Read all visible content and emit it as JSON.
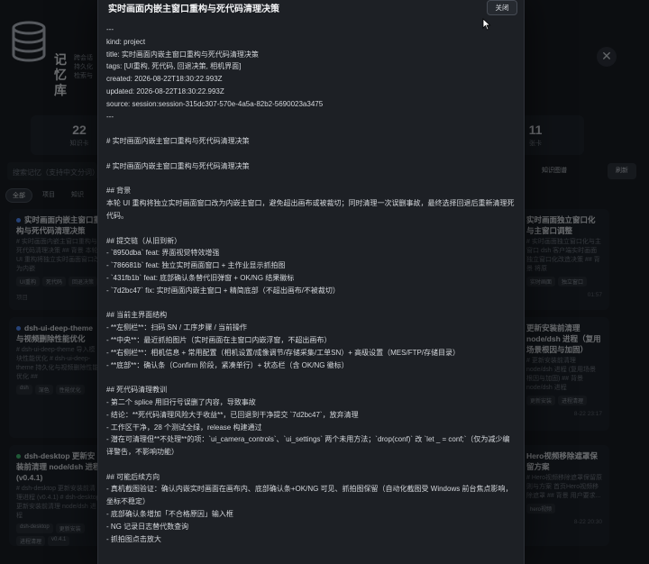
{
  "background": {
    "app_title": "记忆库",
    "app_subtitle": "跨会话持久化检索与大脑",
    "stats": [
      {
        "num": "22",
        "label": "知识卡"
      },
      {
        "num": "11",
        "label": "张卡"
      }
    ],
    "search_placeholder": "搜索记忆（支持中文分词）",
    "btn_sync": "知识图谱",
    "btn_refresh": "刷新",
    "filters": [
      "全部",
      "项目",
      "知识"
    ],
    "cards": [
      {
        "title": "实时画面内嵌主窗口重构与死代码清理决策",
        "desc": "# 实时画面内嵌主窗口重构与死代码清理决策 ## 背景 本轮 UI 重构将独立实时画面窗口改为内嵌",
        "tags": [
          "UI重构",
          "死代码",
          "回退决策"
        ],
        "meta_left": "项目",
        "meta_right": "",
        "dot": "#4f8cff"
      },
      {
        "title": "dsh-ui-deep-theme 与视频删除性能优化",
        "desc": "# dsh-ui-deep-theme 导入模块性能优化 # dsh-ui-deep-theme 持久化与视频删除性能优化 ##",
        "tags": [
          "dsh",
          "深色",
          "性能优化"
        ],
        "meta_left": "",
        "meta_right": "",
        "dot": "#4f8cff"
      },
      {
        "title": "dsh-desktop 更新安装前清理 node/dsh 进程 (v0.4.1)",
        "desc": "# dsh-desktop 更新安装前清理进程 (v0.4.1) # dsh-desktop 更新安装前清理 node/dsh 进程",
        "tags": [
          "dsh-desktop",
          "更新安装",
          "进程清理",
          "v0.4.1"
        ],
        "meta_left": "知识",
        "meta_right": "",
        "dot": "#3fbf6f"
      },
      {
        "title": "实时画面独立窗口化与主窗口调整",
        "desc": "# 实时画面独立窗口化与主窗口 dsh 客户端实时画面独立窗口化改造决策 ## 背景 将原",
        "tags": [
          "实时画面",
          "独立窗口"
        ],
        "meta_left": "",
        "meta_right": "01:57",
        "dot": "#4f8cff"
      },
      {
        "title": "更新安装前清理 node/dsh 进程（复用场景根因与加固）",
        "desc": "# 更新安装前清理 node/dsh 进程 (复用场景根因与加固) ## 背景 node/dsh 进程",
        "tags": [
          "更新安装",
          "进程清理"
        ],
        "meta_left": "",
        "meta_right": "8-22 23:17",
        "dot": "#4f8cff"
      },
      {
        "title": "Hero视频移除遮罩保留方案",
        "desc": "# Hero视频移除遮罩保留原则与方案 首页Hero视频移除遮罩 ## 背景 用户要求...",
        "tags": [
          "hero视频"
        ],
        "meta_left": "",
        "meta_right": "8-22 20:30",
        "dot": "#4f8cff"
      }
    ]
  },
  "modal": {
    "title": "实时画面内嵌主窗口重构与死代码清理决策",
    "close_label": "关闭",
    "lines": [
      "---",
      "kind: project",
      "title: 实时画面内嵌主窗口重构与死代码清理决策",
      "tags: [UI重构, 死代码, 回退决策, 相机界面]",
      "created: 2026-08-22T18:30:22.993Z",
      "updated: 2026-08-22T18:30:22.993Z",
      "source: session:session-315dc307-570e-4a5a-82b2-5690023a3475",
      "---",
      "",
      "# 实时画面内嵌主窗口重构与死代码清理决策",
      "",
      "# 实时画面内嵌主窗口重构与死代码清理决策",
      "",
      "## 背景",
      "本轮 UI 重构将独立实时画面窗口改为内嵌主窗口，避免超出画布或被裁切；同时清理一次误删事故，最终选择回退后重新清理死代码。",
      "",
      "## 提交链（从旧到新）",
      "- `8950dba` feat: 界面视觉特效增强",
      "- `786681b` feat: 独立实时画面窗口 + 主作业显示抓拍图",
      "- `431fb1b` feat: 底部确认条替代旧弹窗 + OK/NG 结果徽标",
      "- `7d2bc47` fix: 实时画面内嵌主窗口 + 精简底部（不超出画布/不被裁切）",
      "",
      "## 当前主界面结构",
      "- **左侧栏**：扫码 SN / 工序步骤 / 当前操作",
      "- **中央**：最近抓拍图片（实时画面在主窗口内嵌浮窗，不超出画布）",
      "- **右侧栏**：相机信息 + 常用配置（相机设置/成像调节/存储采集/工单SN）+ 高级设置（MES/FTP/存储目录）",
      "- **底部**：确认条（Confirm 阶段，紧凑单行）+ 状态栏（含 OK/NG 徽标）",
      "",
      "## 死代码清理教训",
      "- 第二个 splice 用旧行号误删了内容，导致事故",
      "- 结论：**死代码清理风险大于收益**，已回退到干净提交 `7d2bc47`，放弃清理",
      "- 工作区干净，28 个测试全绿，release 构建通过",
      "- 潜在可清理但**不处理**的项：`ui_camera_controls`、`ui_settings` 两个未用方法；`drop(conf)` 改 `let _ = conf;`（仅为减少编译警告，不影响功能）",
      "",
      "## 可能后续方向",
      "- 真机截图验证：确认内嵌实时画面在画布内、底部确认条+OK/NG 可见、抓拍图保留（自动化截图受 Windows 前台焦点影响，坐标不稳定）",
      "- 底部确认条增加「不合格原因」输入框",
      "- NG 记录日志替代数查询",
      "- 抓拍图点击放大"
    ]
  }
}
